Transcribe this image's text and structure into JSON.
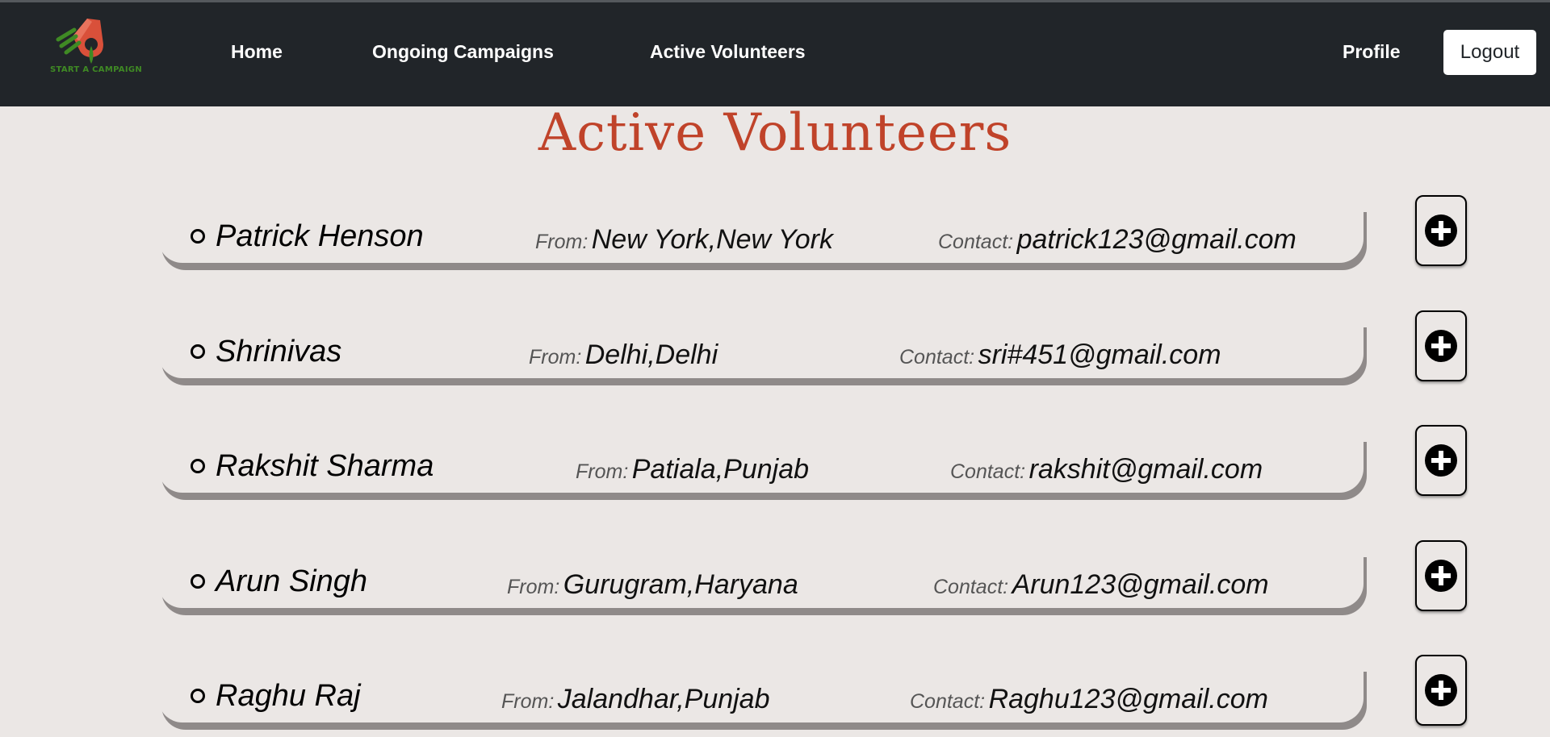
{
  "brand": {
    "logo_text": "START A CAMPAIGN"
  },
  "nav": {
    "home": "Home",
    "campaigns": "Ongoing Campaigns",
    "volunteers": "Active Volunteers",
    "profile": "Profile",
    "logout": "Logout"
  },
  "page_title": "Active Volunteers",
  "labels": {
    "from": "From:",
    "contact": "Contact:"
  },
  "volunteers": [
    {
      "name": "Patrick Henson",
      "from": "New York,New York",
      "contact": "patrick123@gmail.com"
    },
    {
      "name": "Shrinivas",
      "from": "Delhi,Delhi",
      "contact": "sri#451@gmail.com"
    },
    {
      "name": "Rakshit Sharma",
      "from": "Patiala,Punjab",
      "contact": "rakshit@gmail.com"
    },
    {
      "name": "Arun Singh",
      "from": "Gurugram,Haryana",
      "contact": "Arun123@gmail.com"
    },
    {
      "name": "Raghu Raj",
      "from": "Jalandhar,Punjab",
      "contact": "Raghu123@gmail.com"
    }
  ],
  "colors": {
    "navbar": "#212529",
    "title": "#c0432a",
    "background": "#ebe7e5"
  }
}
